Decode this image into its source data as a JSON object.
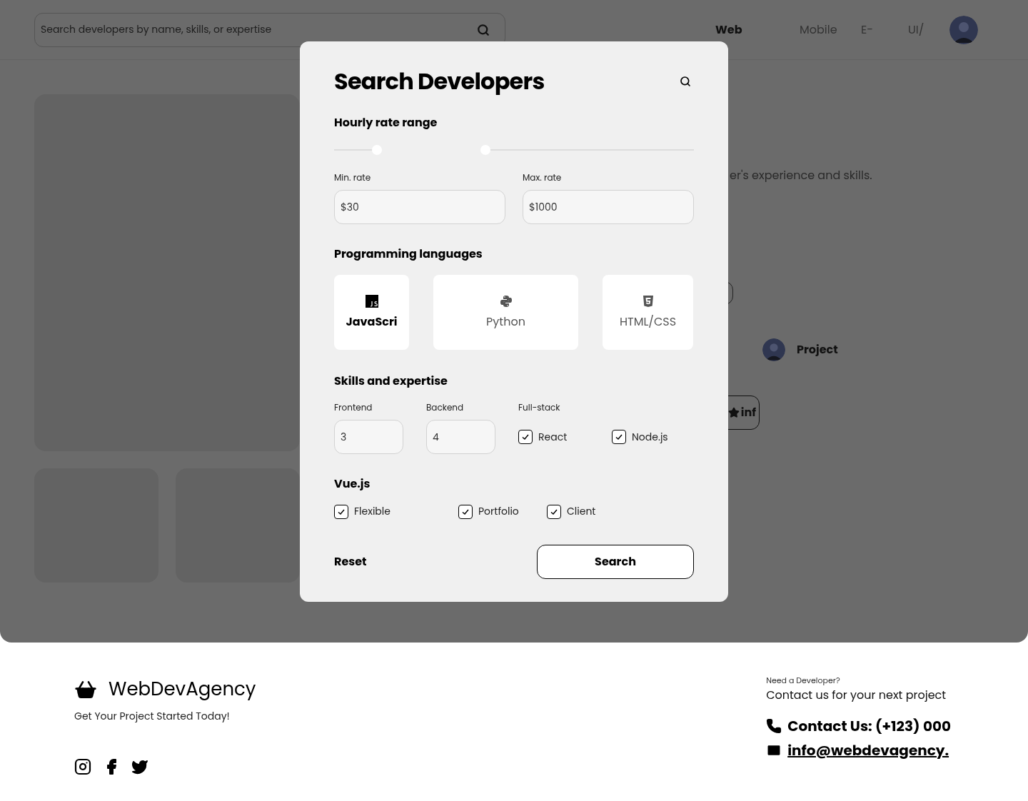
{
  "header": {
    "search": {
      "placeholder": "Search developers by name, skills, or expertise"
    },
    "nav": [
      {
        "label": "Web",
        "selected": true
      },
      {
        "label": "Mobile",
        "selected": false
      },
      {
        "label": "E-",
        "selected": false
      },
      {
        "label": "UI/",
        "selected": false
      }
    ]
  },
  "background": {
    "description": "er's experience and skills.",
    "profile": {
      "label": "Project"
    },
    "button": {
      "label": "inf"
    }
  },
  "modal": {
    "title": "Search Developers",
    "rate": {
      "heading": "Hourly rate range",
      "thumbs": [
        {
          "level": 0.12
        },
        {
          "level": 0.42
        }
      ],
      "fields": [
        {
          "label": "Min. rate",
          "value": "$30"
        },
        {
          "label": "Max. rate",
          "value": "$1000"
        }
      ]
    },
    "languages": {
      "heading": "Programming languages",
      "items": [
        {
          "kind": "js",
          "label": "JavaScri",
          "selected": true
        },
        {
          "kind": "python",
          "label": "Python",
          "selected": false
        },
        {
          "kind": "html",
          "label": "HTML/CSS",
          "selected": false
        }
      ]
    },
    "skills": {
      "heading": "Skills and expertise",
      "fields": [
        {
          "label": "Frontend",
          "value": "3"
        },
        {
          "label": "Backend",
          "value": "4"
        }
      ],
      "group_label": "Full-stack",
      "checks": [
        {
          "label": "React",
          "checked": true
        },
        {
          "label": "Node.js",
          "checked": true
        }
      ]
    },
    "vue": {
      "heading": "Vue.js",
      "checks": [
        {
          "label": "Flexible",
          "checked": true
        },
        {
          "label": "Portfolio",
          "checked": true
        },
        {
          "label": "Client",
          "checked": true
        }
      ]
    },
    "reset": "Reset",
    "search": "Search"
  },
  "footer": {
    "brand": "WebDevAgency",
    "tagline": "Get Your Project Started Today!",
    "cta_small": "Need a Developer?",
    "cta": "Contact us for your next project",
    "phone": "Contact Us: (+123) 000",
    "email": "info@webdevagency."
  }
}
